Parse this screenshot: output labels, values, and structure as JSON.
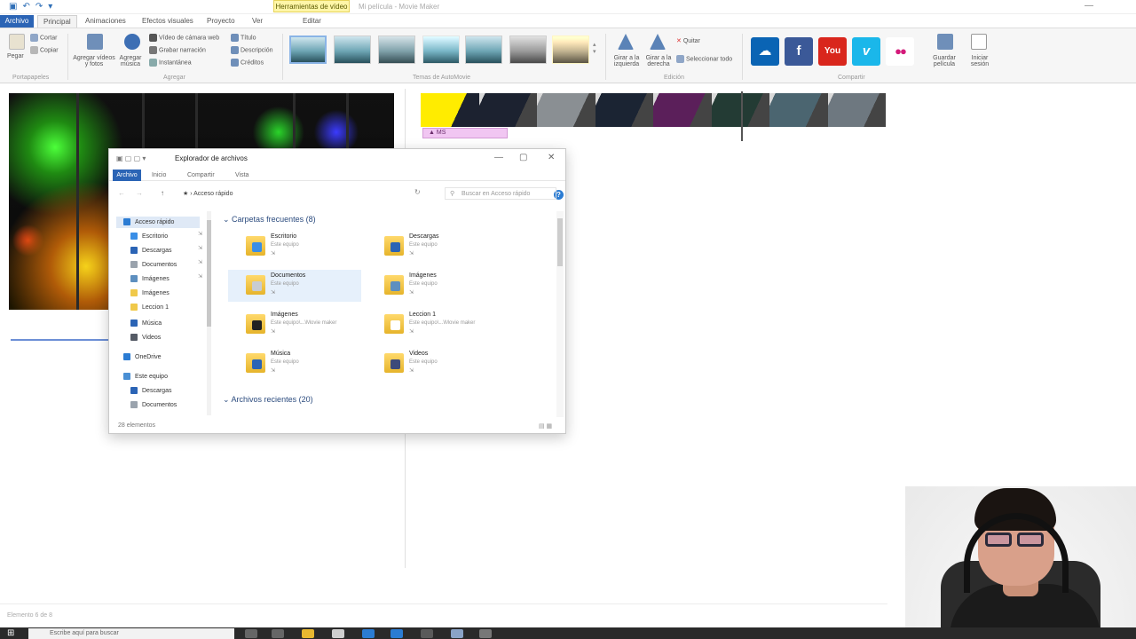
{
  "app": {
    "title": "Mi película - Movie Maker",
    "tools_tab": "Herramientas de vídeo",
    "quick_access": [
      "▣",
      "↶",
      "↷",
      "▾"
    ],
    "window_min": "—"
  },
  "tabs": [
    "Archivo",
    "Principal",
    "Animaciones",
    "Efectos visuales",
    "Proyecto",
    "Ver",
    "Editar"
  ],
  "ribbon": {
    "clipboard": {
      "paste": "Pegar",
      "cut": "Cortar",
      "copy": "Copiar",
      "group": "Portapapeles"
    },
    "add": {
      "add_videos": "Agregar vídeos y fotos",
      "add_music": "Agregar música",
      "webcam": "Vídeo de cámara web",
      "narration": "Grabar narración",
      "snapshot": "Instantánea",
      "title": "Título",
      "caption": "Descripción",
      "credits": "Créditos",
      "group": "Agregar"
    },
    "themes_group": "Temas de AutoMovie",
    "editing": {
      "rotate_left": "Girar a la izquierda",
      "rotate_right": "Girar a la derecha",
      "remove": "Quitar",
      "select_all": "Seleccionar todo",
      "group": "Edición"
    },
    "share": {
      "services": [
        {
          "name": "onedrive-icon",
          "glyph": "☁",
          "color": "#0a64b4"
        },
        {
          "name": "facebook-icon",
          "glyph": "f",
          "color": "#3b5998"
        },
        {
          "name": "youtube-icon",
          "glyph": "You",
          "color": "#d9261c"
        },
        {
          "name": "vimeo-icon",
          "glyph": "v",
          "color": "#1ab7ea"
        },
        {
          "name": "flickr-icon",
          "glyph": "●●",
          "color": "#ffffff"
        }
      ],
      "save_movie": "Guardar película",
      "sign_in": "Iniciar sesión",
      "group": "Compartir"
    }
  },
  "storyboard": {
    "label": "▲ MS",
    "clip_colors": [
      "#ffec00",
      "#1c2230",
      "#8a8f93",
      "#1b2433",
      "#5b1f5a",
      "#233b34",
      "#4b6570",
      "#6e7880"
    ]
  },
  "explorer": {
    "title": "Explorador de archivos",
    "title_icons": "▣ ▢ ▢ ▾",
    "win_buttons": [
      "—",
      "▢",
      "✕"
    ],
    "tabs": [
      "Archivo",
      "Inicio",
      "Compartir",
      "Vista"
    ],
    "help": "?",
    "nav_buttons": [
      "←",
      "→",
      "↑"
    ],
    "address": "★ › Acceso rápido",
    "refresh": "↻",
    "search_placeholder": "Buscar en Acceso rápido",
    "nav_pane": [
      {
        "label": "Acceso rápido",
        "color": "#2b7cd3",
        "selected": true,
        "pinned": false
      },
      {
        "label": "Escritorio",
        "color": "#3a8ee6",
        "selected": false,
        "pinned": true
      },
      {
        "label": "Descargas",
        "color": "#2b64b5",
        "selected": false,
        "pinned": true
      },
      {
        "label": "Documentos",
        "color": "#9aa3ad",
        "selected": false,
        "pinned": true
      },
      {
        "label": "Imágenes",
        "color": "#5d8fbf",
        "selected": false,
        "pinned": true
      },
      {
        "label": "Imágenes",
        "color": "#f0c94a",
        "selected": false,
        "pinned": false
      },
      {
        "label": "Leccion 1",
        "color": "#f0c94a",
        "selected": false,
        "pinned": false
      },
      {
        "label": "Música",
        "color": "#2b64b5",
        "selected": false,
        "pinned": false
      },
      {
        "label": "Videos",
        "color": "#555b66",
        "selected": false,
        "pinned": false
      },
      {
        "label": "OneDrive",
        "color": "#2b7cd3",
        "selected": false,
        "pinned": false
      },
      {
        "label": "Este equipo",
        "color": "#4a8fd4",
        "selected": false,
        "pinned": false
      },
      {
        "label": "Descargas",
        "color": "#2b64b5",
        "selected": false,
        "pinned": false
      },
      {
        "label": "Documentos",
        "color": "#9aa3ad",
        "selected": false,
        "pinned": false
      }
    ],
    "frequent_header": "Carpetas frecuentes (8)",
    "frequent": [
      {
        "name": "Escritorio",
        "sub": "Este equipo",
        "badge": "#3a8ee6",
        "selected": false
      },
      {
        "name": "Descargas",
        "sub": "Este equipo",
        "badge": "#2b64b5",
        "selected": false
      },
      {
        "name": "Documentos",
        "sub": "Este equipo",
        "badge": "#c8ccd2",
        "selected": true
      },
      {
        "name": "Imágenes",
        "sub": "Este equipo",
        "badge": "#5d8fbf",
        "selected": false
      },
      {
        "name": "Imágenes",
        "sub": "Este equipo\\...\\Movie maker",
        "badge": "#222222",
        "selected": false
      },
      {
        "name": "Leccion 1",
        "sub": "Este equipo\\...\\Movie maker",
        "badge": "#ffffff",
        "selected": false
      },
      {
        "name": "Música",
        "sub": "Este equipo",
        "badge": "#2b64b5",
        "selected": false
      },
      {
        "name": "Videos",
        "sub": "Este equipo",
        "badge": "#3d4a7a",
        "selected": false
      }
    ],
    "recent_header": "Archivos recientes (20)",
    "pin_glyph": "⇲",
    "status": "28 elementos",
    "view_icons": "▤ ▦"
  },
  "app_status": "Elemento 6 de 8",
  "taskbar": {
    "start": "⊞",
    "search_placeholder": "Escribe aquí para buscar"
  }
}
